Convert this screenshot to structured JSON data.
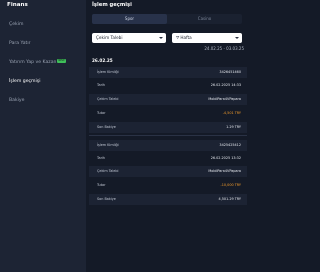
{
  "sidebar": {
    "title": "Finans",
    "items": [
      {
        "label": "Çekim"
      },
      {
        "label": "Para Yatır"
      },
      {
        "label": "Yatırım Yap ve Kazan",
        "badge": "NEW"
      },
      {
        "label": "İşlem geçmişi"
      },
      {
        "label": "Bakiye"
      }
    ]
  },
  "main": {
    "title": "İşlem geçmişi",
    "tabs": [
      {
        "label": "Spor"
      },
      {
        "label": "Casino"
      }
    ],
    "filter_type": {
      "value": "Çekim Talebi"
    },
    "filter_period": {
      "value": "Hafta"
    },
    "date_range": "24.02.25 - 03.03.25",
    "date_header": "26.02.25",
    "transactions": [
      {
        "rows": [
          {
            "label": "İşlem Kimliği",
            "value": "3426451460"
          },
          {
            "label": "Tarih",
            "value": "26.02.2025 14:33"
          },
          {
            "label": "Çekim Talebi",
            "value": "MobilPara4VPapara"
          },
          {
            "label": "Tutar",
            "value": "-4,501 TRY"
          },
          {
            "label": "Son Bakiye",
            "value": "1.29 TRY"
          }
        ]
      },
      {
        "rows": [
          {
            "label": "İşlem Kimliği",
            "value": "3425425412"
          },
          {
            "label": "Tarih",
            "value": "26.02.2025 13:32"
          },
          {
            "label": "Çekim Talebi",
            "value": "MobilPara4VPapara"
          },
          {
            "label": "Tutar",
            "value": "-10,000 TRY"
          },
          {
            "label": "Son Bakiye",
            "value": "4,501.29 TRY"
          }
        ]
      }
    ]
  },
  "colors": {
    "accent_negative": "#f39c2b",
    "badge": "#3fbf5a"
  }
}
